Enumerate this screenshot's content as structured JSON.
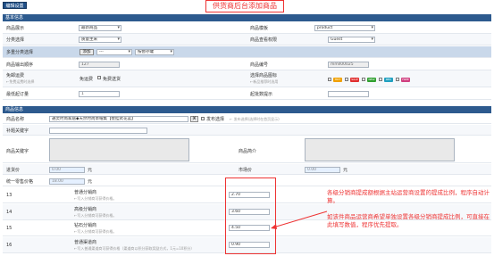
{
  "tab": {
    "label": "编辑设置"
  },
  "banner": {
    "text": "供货商后台添加商品"
  },
  "section1": {
    "title": "基本信息"
  },
  "basic": {
    "display_label": "商品展示",
    "display_value": "最新商品",
    "template_label": "商品模板",
    "template_value": "product",
    "category_label": "分类选择",
    "category_value": "质量主采",
    "view_perm_label": "商品查看权限",
    "view_perm_value": "Guest",
    "multi_cat_label": "多重分类选择",
    "multi_cat_add": "添加",
    "multi_cat_select": "---",
    "multi_cat_select2": "按暂存罐",
    "sort_label": "商品输出顺序",
    "sort_value": "127",
    "sn_label": "商品编号",
    "sn_value": "mmll00025",
    "shipping_label": "免邮运费",
    "shipping_option": "免运费",
    "shipping_hint": "←免费运费时选择",
    "shipping_checkbox_label": "免费送货",
    "icon_label": "选择商品图标",
    "icon_hint": "←新品推荐时选用",
    "min_order_label": "最低起订量",
    "min_order_value": "1",
    "restock_label": "起批数提示",
    "badges": [
      {
        "text": "HOT",
        "color": "#f0a000"
      },
      {
        "text": "SALE",
        "color": "#e03030"
      },
      {
        "text": "NEW",
        "color": "#30a030"
      },
      {
        "text": "REC",
        "color": "#20a0c0"
      },
      {
        "text": "FREE",
        "color": "#d04080"
      }
    ]
  },
  "section2": {
    "title": "商品信息"
  },
  "info": {
    "name_label": "商品名称",
    "name_value": "通灵时尚家居◆天然时尚草帽集【壁挂式花篮】",
    "name_button": "关",
    "name_check_label": "发布选择",
    "name_hint": "← 发布选择(选择时在首页显示)",
    "extra_name_label": "补题关键字",
    "keywords_label": "商品关键字",
    "intro_label": "商品简介",
    "cost_label": "进货价",
    "cost_value": "0.00",
    "cost_unit": "元",
    "market_label": "市场价",
    "market_value": "0.00",
    "market_unit": "元",
    "retail_label": "统一零售价格",
    "retail_value": "18.00",
    "retail_unit": "元"
  },
  "levels": [
    {
      "num": "13",
      "name": "普通分销商",
      "hint": "←写入分销商可获得价格。",
      "value": "2.70"
    },
    {
      "num": "14",
      "name": "高级分销商",
      "hint": "←写入分销商可获得价格。",
      "value": "3.60"
    },
    {
      "num": "15",
      "name": "钻石分销商",
      "hint": "←写入分销商可获得价格。",
      "value": "4.50"
    },
    {
      "num": "16",
      "name": "普通渠道商",
      "hint": "←写入普通渠道商可获得价格（渠道商以积分获取奖励方式，1元=10积分）",
      "value": "0.90"
    }
  ],
  "notes": {
    "note1": "各级分销商提成额根据主站运营商设置的提成比例，程序自动计算。",
    "note2": "如该件商品运营商希望单独设置各级分销商提成比例，可直接在此填写数值，程序优先提取。"
  }
}
